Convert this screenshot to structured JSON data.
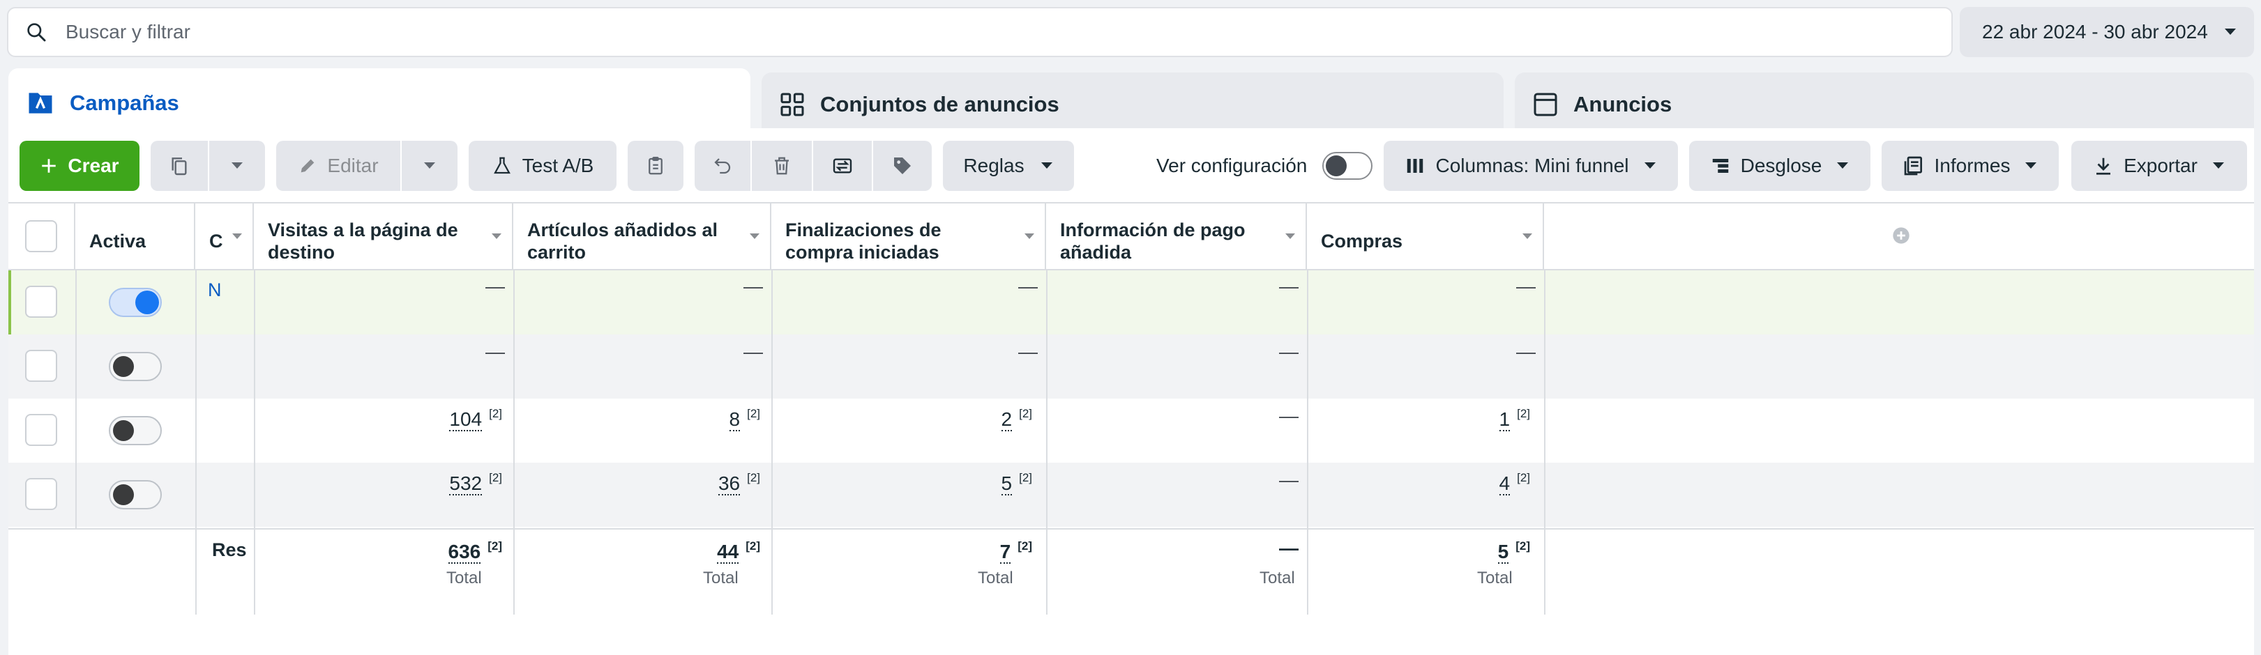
{
  "search": {
    "placeholder": "Buscar y filtrar",
    "icon": "search-icon"
  },
  "date_range": {
    "label": "22 abr 2024 - 30 abr 2024"
  },
  "tabs": [
    {
      "label": "Campañas",
      "icon": "campaign-flag-icon",
      "active": true
    },
    {
      "label": "Conjuntos de anuncios",
      "icon": "grid-icon",
      "active": false
    },
    {
      "label": "Anuncios",
      "icon": "ad-window-icon",
      "active": false
    }
  ],
  "toolbar": {
    "create": "Crear",
    "edit": "Editar",
    "ab_test": "Test A/B",
    "rules": "Reglas",
    "view_setup": "Ver configuración",
    "columns": "Columnas: Mini funnel",
    "breakdown": "Desglose",
    "reports": "Informes",
    "export": "Exportar"
  },
  "columns": {
    "active": "Activa",
    "campaign": "C",
    "landing_views": "Visitas a la página de destino",
    "add_to_cart": "Artículos añadidos al carrito",
    "checkouts": "Finalizaciones de compra iniciadas",
    "payment_info": "Información de pago añadida",
    "purchases": "Compras"
  },
  "rows": [
    {
      "name": "N",
      "active": true,
      "landing_views": "—",
      "add_to_cart": "—",
      "checkouts": "—",
      "payment_info": "—",
      "purchases": "—"
    },
    {
      "name": "",
      "active": false,
      "landing_views": "—",
      "add_to_cart": "—",
      "checkouts": "—",
      "payment_info": "—",
      "purchases": "—"
    },
    {
      "name": "",
      "active": false,
      "landing_views": "104",
      "add_to_cart": "8",
      "checkouts": "2",
      "payment_info": "—",
      "purchases": "1"
    },
    {
      "name": "",
      "active": false,
      "landing_views": "532",
      "add_to_cart": "36",
      "checkouts": "5",
      "payment_info": "—",
      "purchases": "4"
    }
  ],
  "footnote_marker": "[2]",
  "summary": {
    "label": "Res",
    "landing_views": "636",
    "add_to_cart": "44",
    "checkouts": "7",
    "payment_info": "—",
    "purchases": "5",
    "total_label": "Total"
  },
  "colors": {
    "accent": "#0a5cc2",
    "create": "#3ea61b",
    "toggle_on": "#1877f2"
  }
}
